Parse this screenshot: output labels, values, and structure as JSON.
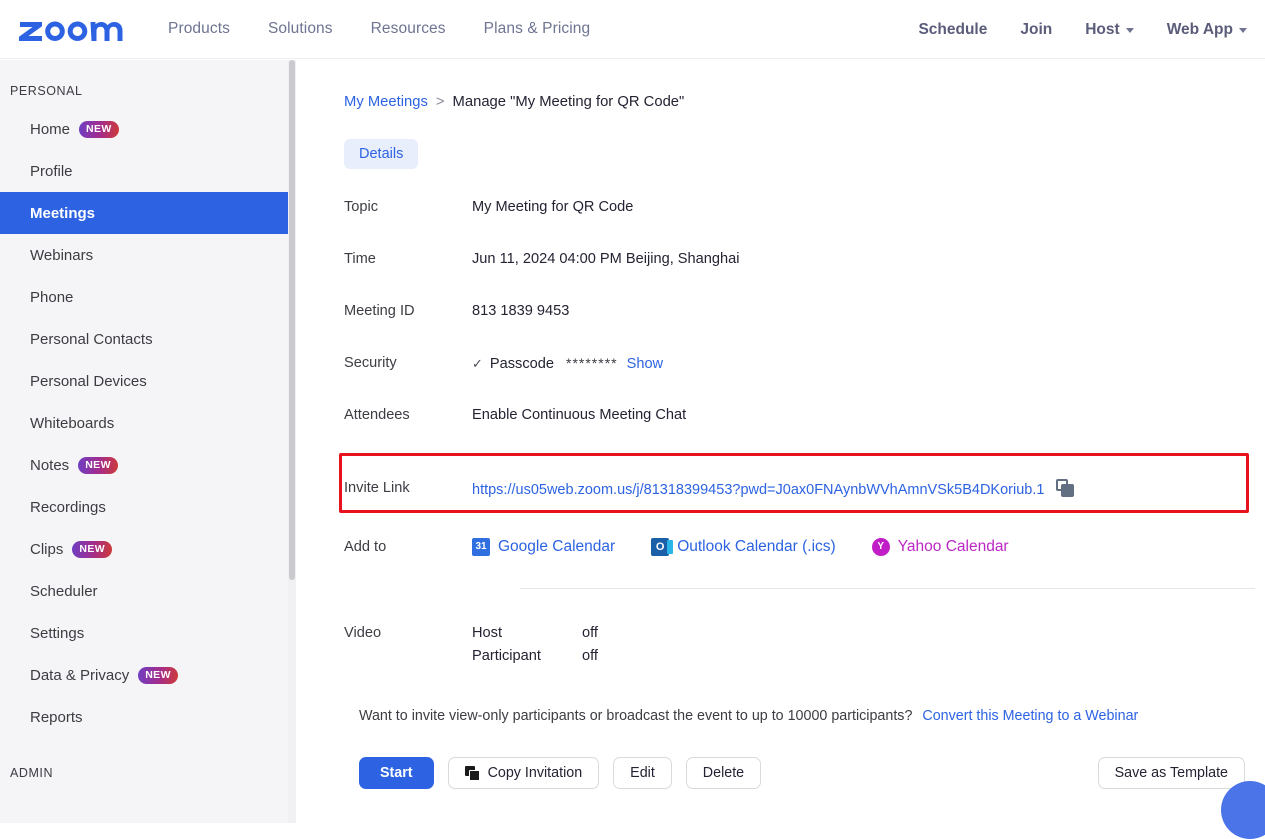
{
  "brand": {
    "name": "zoom",
    "color": "#2d63e2"
  },
  "topnav": {
    "left_items": [
      {
        "label": "Products"
      },
      {
        "label": "Solutions"
      },
      {
        "label": "Resources"
      },
      {
        "label": "Plans & Pricing"
      }
    ],
    "right_items": [
      {
        "label": "Schedule",
        "caret": false
      },
      {
        "label": "Join",
        "caret": false
      },
      {
        "label": "Host",
        "caret": true
      },
      {
        "label": "Web App",
        "caret": true
      }
    ]
  },
  "sidebar": {
    "sections": [
      {
        "title": "PERSONAL"
      },
      {
        "title": "ADMIN"
      }
    ],
    "items": [
      {
        "label": "Home",
        "badge": "NEW",
        "active": false
      },
      {
        "label": "Profile",
        "badge": "",
        "active": false
      },
      {
        "label": "Meetings",
        "badge": "",
        "active": true
      },
      {
        "label": "Webinars",
        "badge": "",
        "active": false
      },
      {
        "label": "Phone",
        "badge": "",
        "active": false
      },
      {
        "label": "Personal Contacts",
        "badge": "",
        "active": false
      },
      {
        "label": "Personal Devices",
        "badge": "",
        "active": false
      },
      {
        "label": "Whiteboards",
        "badge": "",
        "active": false
      },
      {
        "label": "Notes",
        "badge": "NEW",
        "active": false
      },
      {
        "label": "Recordings",
        "badge": "",
        "active": false
      },
      {
        "label": "Clips",
        "badge": "NEW",
        "active": false
      },
      {
        "label": "Scheduler",
        "badge": "",
        "active": false
      },
      {
        "label": "Settings",
        "badge": "",
        "active": false
      },
      {
        "label": "Data & Privacy",
        "badge": "NEW",
        "active": false
      },
      {
        "label": "Reports",
        "badge": "",
        "active": false
      }
    ]
  },
  "breadcrumb": {
    "parent": "My Meetings",
    "separator": ">",
    "current": "Manage \"My Meeting for QR Code\""
  },
  "tabs": [
    {
      "label": "Details",
      "active": true
    }
  ],
  "details": {
    "topic": {
      "label": "Topic",
      "value": "My Meeting for QR Code"
    },
    "time": {
      "label": "Time",
      "value": "Jun 11, 2024 04:00 PM Beijing, Shanghai"
    },
    "meeting_id": {
      "label": "Meeting ID",
      "value": "813 1839 9453"
    },
    "security": {
      "label": "Security",
      "check": "✓",
      "passcode_label": "Passcode",
      "passcode_masked": "********",
      "show_link": "Show"
    },
    "attendees": {
      "label": "Attendees",
      "value": "Enable Continuous Meeting Chat"
    },
    "invite_link": {
      "label": "Invite Link",
      "url": "https://us05web.zoom.us/j/81318399453?pwd=J0ax0FNAynbWVhAmnVSk5B4DKoriub.1",
      "copy_icon": "copy-icon",
      "highlight_color": "#e8111e"
    },
    "add_to": {
      "label": "Add to",
      "options": [
        {
          "label": "Google Calendar",
          "icon": "google-calendar-icon",
          "glyph": "31",
          "color": "#2d63e2"
        },
        {
          "label": "Outlook Calendar (.ics)",
          "icon": "outlook-calendar-icon",
          "glyph": "O",
          "color": "#2d63e2"
        },
        {
          "label": "Yahoo Calendar",
          "icon": "yahoo-calendar-icon",
          "glyph": "Y",
          "color": "#bb27c4"
        }
      ]
    },
    "video": {
      "label": "Video",
      "rows": [
        {
          "who": "Host",
          "state": "off"
        },
        {
          "who": "Participant",
          "state": "off"
        }
      ]
    }
  },
  "webinar_note": {
    "text": "Want to invite view-only participants or broadcast the event to up to 10000 participants?",
    "link": "Convert this Meeting to a Webinar"
  },
  "actions": {
    "start": "Start",
    "copy_invitation": "Copy Invitation",
    "edit": "Edit",
    "delete": "Delete",
    "save_as_template": "Save as Template"
  }
}
